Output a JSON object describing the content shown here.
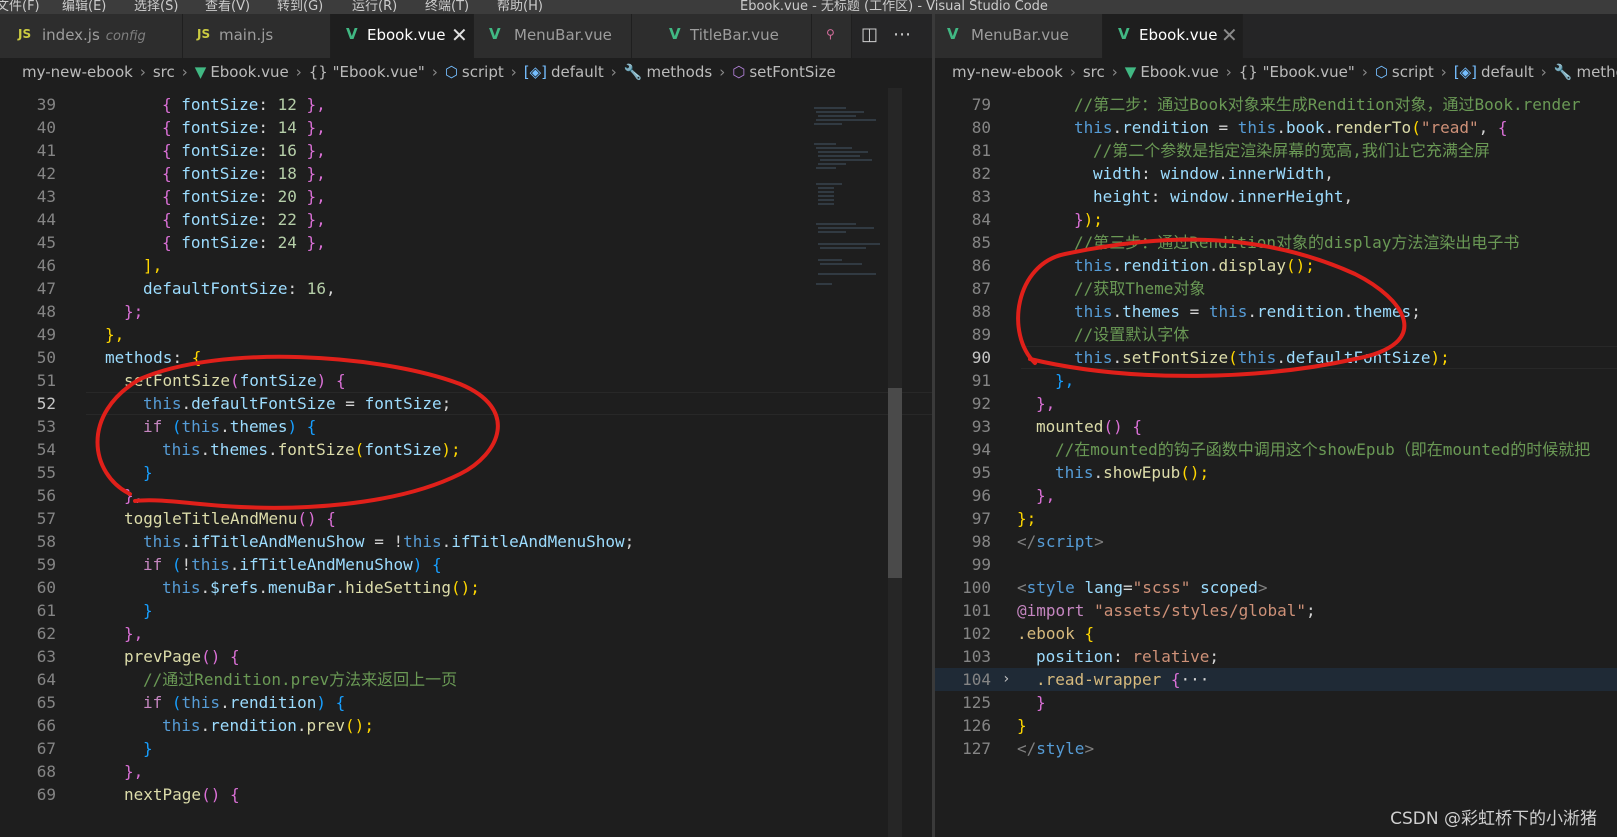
{
  "menubar": {
    "items": [
      "文件(F)",
      "编辑(E)",
      "选择(S)",
      "查看(V)",
      "转到(G)",
      "运行(R)",
      "终端(T)",
      "帮助(H)"
    ],
    "window_title": "Ebook.vue - 无标题 (工作区) - Visual Studio Code"
  },
  "left_pane": {
    "tabs": [
      {
        "icon": "JS",
        "label": "index.js",
        "description": "config",
        "active": false
      },
      {
        "icon": "JS",
        "label": "main.js",
        "active": false
      },
      {
        "icon": "V",
        "label": "Ebook.vue",
        "active": true
      },
      {
        "icon": "V",
        "label": "MenuBar.vue",
        "active": false
      },
      {
        "icon": "V",
        "label": "TitleBar.vue",
        "active": false
      }
    ],
    "breadcrumb": [
      "my-new-ebook",
      "src",
      "Ebook.vue",
      "{} \"Ebook.vue\"",
      "script",
      "default",
      "methods",
      "setFontSize"
    ],
    "current_line": "52"
  },
  "right_pane": {
    "tabs": [
      {
        "icon": "V",
        "label": "MenuBar.vue",
        "active": false
      },
      {
        "icon": "V",
        "label": "Ebook.vue",
        "active": true
      }
    ],
    "breadcrumb": [
      "my-new-ebook",
      "src",
      "Ebook.vue",
      "{} \"Ebook.vue\"",
      "script",
      "default",
      "metho"
    ],
    "current_line": "90"
  },
  "left_code": [
    {
      "n": "39",
      "indent": 4,
      "tokens": [
        [
          "{ ",
          "t-pk"
        ],
        [
          "fontSize",
          "t-p"
        ],
        [
          ": ",
          "t-d"
        ],
        [
          "12",
          "t-n"
        ],
        [
          " },",
          "t-pk"
        ]
      ]
    },
    {
      "n": "40",
      "indent": 4,
      "tokens": [
        [
          "{ ",
          "t-pk"
        ],
        [
          "fontSize",
          "t-p"
        ],
        [
          ": ",
          "t-d"
        ],
        [
          "14",
          "t-n"
        ],
        [
          " },",
          "t-pk"
        ]
      ]
    },
    {
      "n": "41",
      "indent": 4,
      "tokens": [
        [
          "{ ",
          "t-pk"
        ],
        [
          "fontSize",
          "t-p"
        ],
        [
          ": ",
          "t-d"
        ],
        [
          "16",
          "t-n"
        ],
        [
          " },",
          "t-pk"
        ]
      ]
    },
    {
      "n": "42",
      "indent": 4,
      "tokens": [
        [
          "{ ",
          "t-pk"
        ],
        [
          "fontSize",
          "t-p"
        ],
        [
          ": ",
          "t-d"
        ],
        [
          "18",
          "t-n"
        ],
        [
          " },",
          "t-pk"
        ]
      ]
    },
    {
      "n": "43",
      "indent": 4,
      "tokens": [
        [
          "{ ",
          "t-pk"
        ],
        [
          "fontSize",
          "t-p"
        ],
        [
          ": ",
          "t-d"
        ],
        [
          "20",
          "t-n"
        ],
        [
          " },",
          "t-pk"
        ]
      ]
    },
    {
      "n": "44",
      "indent": 4,
      "tokens": [
        [
          "{ ",
          "t-pk"
        ],
        [
          "fontSize",
          "t-p"
        ],
        [
          ": ",
          "t-d"
        ],
        [
          "22",
          "t-n"
        ],
        [
          " },",
          "t-pk"
        ]
      ]
    },
    {
      "n": "45",
      "indent": 4,
      "tokens": [
        [
          "{ ",
          "t-pk"
        ],
        [
          "fontSize",
          "t-p"
        ],
        [
          ": ",
          "t-d"
        ],
        [
          "24",
          "t-n"
        ],
        [
          " },",
          "t-pk"
        ]
      ]
    },
    {
      "n": "46",
      "indent": 3,
      "tokens": [
        [
          "],",
          "t-y"
        ]
      ]
    },
    {
      "n": "47",
      "indent": 3,
      "tokens": [
        [
          "defaultFontSize",
          "t-p"
        ],
        [
          ": ",
          "t-d"
        ],
        [
          "16",
          "t-n"
        ],
        [
          ",",
          "t-d"
        ]
      ]
    },
    {
      "n": "48",
      "indent": 2,
      "tokens": [
        [
          "};",
          "t-pk"
        ]
      ]
    },
    {
      "n": "49",
      "indent": 1,
      "tokens": [
        [
          "},",
          "t-y"
        ]
      ]
    },
    {
      "n": "50",
      "indent": 1,
      "tokens": [
        [
          "methods",
          "t-p"
        ],
        [
          ": ",
          "t-d"
        ],
        [
          "{",
          "t-y"
        ]
      ]
    },
    {
      "n": "51",
      "indent": 2,
      "tokens": [
        [
          "setFontSize",
          "t-f"
        ],
        [
          "(",
          "t-pk"
        ],
        [
          "fontSize",
          "t-p"
        ],
        [
          ") ",
          "t-pk"
        ],
        [
          "{",
          "t-pk"
        ]
      ]
    },
    {
      "n": "52",
      "indent": 3,
      "tokens": [
        [
          "this",
          "t-k"
        ],
        [
          ".",
          "t-d"
        ],
        [
          "defaultFontSize",
          "t-p"
        ],
        [
          " = ",
          "t-d"
        ],
        [
          "fontSize",
          "t-p"
        ],
        [
          ";",
          "t-d"
        ]
      ]
    },
    {
      "n": "53",
      "indent": 3,
      "tokens": [
        [
          "if",
          "t-c"
        ],
        [
          " (",
          "t-b"
        ],
        [
          "this",
          "t-k"
        ],
        [
          ".",
          "t-d"
        ],
        [
          "themes",
          "t-p"
        ],
        [
          ") ",
          "t-b"
        ],
        [
          "{",
          "t-b"
        ]
      ]
    },
    {
      "n": "54",
      "indent": 4,
      "tokens": [
        [
          "this",
          "t-k"
        ],
        [
          ".",
          "t-d"
        ],
        [
          "themes",
          "t-p"
        ],
        [
          ".",
          "t-d"
        ],
        [
          "fontSize",
          "t-f"
        ],
        [
          "(",
          "t-y"
        ],
        [
          "fontSize",
          "t-p"
        ],
        [
          ");",
          "t-y"
        ]
      ]
    },
    {
      "n": "55",
      "indent": 3,
      "tokens": [
        [
          "}",
          "t-b"
        ]
      ]
    },
    {
      "n": "56",
      "indent": 2,
      "tokens": [
        [
          "},",
          "t-pk"
        ]
      ]
    },
    {
      "n": "57",
      "indent": 2,
      "tokens": [
        [
          "toggleTitleAndMenu",
          "t-f"
        ],
        [
          "() ",
          "t-pk"
        ],
        [
          "{",
          "t-pk"
        ]
      ]
    },
    {
      "n": "58",
      "indent": 3,
      "tokens": [
        [
          "this",
          "t-k"
        ],
        [
          ".",
          "t-d"
        ],
        [
          "ifTitleAndMenuShow",
          "t-p"
        ],
        [
          " = !",
          "t-d"
        ],
        [
          "this",
          "t-k"
        ],
        [
          ".",
          "t-d"
        ],
        [
          "ifTitleAndMenuShow",
          "t-p"
        ],
        [
          ";",
          "t-d"
        ]
      ]
    },
    {
      "n": "59",
      "indent": 3,
      "tokens": [
        [
          "if",
          "t-c"
        ],
        [
          " (",
          "t-b"
        ],
        [
          "!",
          "t-d"
        ],
        [
          "this",
          "t-k"
        ],
        [
          ".",
          "t-d"
        ],
        [
          "ifTitleAndMenuShow",
          "t-p"
        ],
        [
          ") ",
          "t-b"
        ],
        [
          "{",
          "t-b"
        ]
      ]
    },
    {
      "n": "60",
      "indent": 4,
      "tokens": [
        [
          "this",
          "t-k"
        ],
        [
          ".",
          "t-d"
        ],
        [
          "$refs",
          "t-p"
        ],
        [
          ".",
          "t-d"
        ],
        [
          "menuBar",
          "t-p"
        ],
        [
          ".",
          "t-d"
        ],
        [
          "hideSetting",
          "t-f"
        ],
        [
          "();",
          "t-y"
        ]
      ]
    },
    {
      "n": "61",
      "indent": 3,
      "tokens": [
        [
          "}",
          "t-b"
        ]
      ]
    },
    {
      "n": "62",
      "indent": 2,
      "tokens": [
        [
          "},",
          "t-pk"
        ]
      ]
    },
    {
      "n": "63",
      "indent": 2,
      "tokens": [
        [
          "prevPage",
          "t-f"
        ],
        [
          "() ",
          "t-pk"
        ],
        [
          "{",
          "t-pk"
        ]
      ]
    },
    {
      "n": "64",
      "indent": 3,
      "tokens": [
        [
          "//通过Rendition.prev方法来返回上一页",
          "t-m"
        ]
      ]
    },
    {
      "n": "65",
      "indent": 3,
      "tokens": [
        [
          "if",
          "t-c"
        ],
        [
          " (",
          "t-b"
        ],
        [
          "this",
          "t-k"
        ],
        [
          ".",
          "t-d"
        ],
        [
          "rendition",
          "t-p"
        ],
        [
          ") ",
          "t-b"
        ],
        [
          "{",
          "t-b"
        ]
      ]
    },
    {
      "n": "66",
      "indent": 4,
      "tokens": [
        [
          "this",
          "t-k"
        ],
        [
          ".",
          "t-d"
        ],
        [
          "rendition",
          "t-p"
        ],
        [
          ".",
          "t-d"
        ],
        [
          "prev",
          "t-f"
        ],
        [
          "();",
          "t-y"
        ]
      ]
    },
    {
      "n": "67",
      "indent": 3,
      "tokens": [
        [
          "}",
          "t-b"
        ]
      ]
    },
    {
      "n": "68",
      "indent": 2,
      "tokens": [
        [
          "},",
          "t-pk"
        ]
      ]
    },
    {
      "n": "69",
      "indent": 2,
      "tokens": [
        [
          "nextPage",
          "t-f"
        ],
        [
          "() ",
          "t-pk"
        ],
        [
          "{",
          "t-pk"
        ]
      ]
    }
  ],
  "right_code": [
    {
      "n": "79",
      "indent": 3,
      "tokens": [
        [
          "//第二步：通过Book对象来生成Rendition对象，通过Book.render",
          "t-m"
        ]
      ]
    },
    {
      "n": "80",
      "indent": 3,
      "tokens": [
        [
          "this",
          "t-k"
        ],
        [
          ".",
          "t-d"
        ],
        [
          "rendition",
          "t-p"
        ],
        [
          " = ",
          "t-d"
        ],
        [
          "this",
          "t-k"
        ],
        [
          ".",
          "t-d"
        ],
        [
          "book",
          "t-p"
        ],
        [
          ".",
          "t-d"
        ],
        [
          "renderTo",
          "t-f"
        ],
        [
          "(",
          "t-y"
        ],
        [
          "\"read\"",
          "t-s"
        ],
        [
          ", ",
          "t-d"
        ],
        [
          "{",
          "t-pk"
        ]
      ]
    },
    {
      "n": "81",
      "indent": 4,
      "tokens": [
        [
          "//第二个参数是指定渲染屏幕的宽高,我们让它充满全屏",
          "t-m"
        ]
      ]
    },
    {
      "n": "82",
      "indent": 4,
      "tokens": [
        [
          "width",
          "t-p"
        ],
        [
          ": ",
          "t-d"
        ],
        [
          "window",
          "t-p"
        ],
        [
          ".",
          "t-d"
        ],
        [
          "innerWidth",
          "t-p"
        ],
        [
          ",",
          "t-d"
        ]
      ]
    },
    {
      "n": "83",
      "indent": 4,
      "tokens": [
        [
          "height",
          "t-p"
        ],
        [
          ": ",
          "t-d"
        ],
        [
          "window",
          "t-p"
        ],
        [
          ".",
          "t-d"
        ],
        [
          "innerHeight",
          "t-p"
        ],
        [
          ",",
          "t-d"
        ]
      ]
    },
    {
      "n": "84",
      "indent": 3,
      "tokens": [
        [
          "}",
          "t-pk"
        ],
        [
          ");",
          "t-y"
        ]
      ]
    },
    {
      "n": "85",
      "indent": 3,
      "tokens": [
        [
          "//第三步：通过Rendition对象的display方法渲染出电子书",
          "t-m"
        ]
      ]
    },
    {
      "n": "86",
      "indent": 3,
      "tokens": [
        [
          "this",
          "t-k"
        ],
        [
          ".",
          "t-d"
        ],
        [
          "rendition",
          "t-p"
        ],
        [
          ".",
          "t-d"
        ],
        [
          "display",
          "t-f"
        ],
        [
          "();",
          "t-y"
        ]
      ]
    },
    {
      "n": "87",
      "indent": 3,
      "tokens": [
        [
          "//获取Theme对象",
          "t-m"
        ]
      ]
    },
    {
      "n": "88",
      "indent": 3,
      "tokens": [
        [
          "this",
          "t-k"
        ],
        [
          ".",
          "t-d"
        ],
        [
          "themes",
          "t-p"
        ],
        [
          " = ",
          "t-d"
        ],
        [
          "this",
          "t-k"
        ],
        [
          ".",
          "t-d"
        ],
        [
          "rendition",
          "t-p"
        ],
        [
          ".",
          "t-d"
        ],
        [
          "themes",
          "t-p"
        ],
        [
          ";",
          "t-d"
        ]
      ]
    },
    {
      "n": "89",
      "indent": 3,
      "tokens": [
        [
          "//设置默认字体",
          "t-m"
        ]
      ]
    },
    {
      "n": "90",
      "indent": 3,
      "tokens": [
        [
          "this",
          "t-k"
        ],
        [
          ".",
          "t-d"
        ],
        [
          "setFontSize",
          "t-f"
        ],
        [
          "(",
          "t-y"
        ],
        [
          "this",
          "t-k"
        ],
        [
          ".",
          "t-d"
        ],
        [
          "defaultFontSize",
          "t-p"
        ],
        [
          ");",
          "t-y"
        ]
      ]
    },
    {
      "n": "91",
      "indent": 2,
      "tokens": [
        [
          "},",
          "t-b"
        ]
      ]
    },
    {
      "n": "92",
      "indent": 1,
      "tokens": [
        [
          "},",
          "t-pk"
        ]
      ]
    },
    {
      "n": "93",
      "indent": 1,
      "tokens": [
        [
          "mounted",
          "t-f"
        ],
        [
          "() ",
          "t-pk"
        ],
        [
          "{",
          "t-pk"
        ]
      ]
    },
    {
      "n": "94",
      "indent": 2,
      "tokens": [
        [
          "//在mounted的钩子函数中调用这个showEpub（即在mounted的时候就把",
          "t-m"
        ]
      ]
    },
    {
      "n": "95",
      "indent": 2,
      "tokens": [
        [
          "this",
          "t-k"
        ],
        [
          ".",
          "t-d"
        ],
        [
          "showEpub",
          "t-f"
        ],
        [
          "();",
          "t-y"
        ]
      ]
    },
    {
      "n": "96",
      "indent": 1,
      "tokens": [
        [
          "},",
          "t-pk"
        ]
      ]
    },
    {
      "n": "97",
      "indent": 0,
      "tokens": [
        [
          "};",
          "t-y"
        ]
      ]
    },
    {
      "n": "98",
      "indent": 0,
      "tokens": [
        [
          "</",
          "t-ex"
        ],
        [
          "script",
          "t-tag"
        ],
        [
          ">",
          "t-ex"
        ]
      ]
    },
    {
      "n": "99",
      "indent": 0,
      "tokens": []
    },
    {
      "n": "100",
      "indent": 0,
      "tokens": [
        [
          "<",
          "t-ex"
        ],
        [
          "style",
          "t-tag"
        ],
        [
          " ",
          "t-d"
        ],
        [
          "lang",
          "t-at"
        ],
        [
          "=",
          "t-d"
        ],
        [
          "\"scss\"",
          "t-s"
        ],
        [
          " ",
          "t-d"
        ],
        [
          "scoped",
          "t-at"
        ],
        [
          ">",
          "t-ex"
        ]
      ]
    },
    {
      "n": "101",
      "indent": 0,
      "tokens": [
        [
          "@import",
          "t-c"
        ],
        [
          " ",
          "t-d"
        ],
        [
          "\"assets/styles/global\"",
          "t-s"
        ],
        [
          ";",
          "t-d"
        ]
      ]
    },
    {
      "n": "102",
      "indent": 0,
      "tokens": [
        [
          ".ebook",
          "t-sel"
        ],
        [
          " ",
          "t-d"
        ],
        [
          "{",
          "t-y"
        ]
      ]
    },
    {
      "n": "103",
      "indent": 1,
      "tokens": [
        [
          "position",
          "t-at"
        ],
        [
          ": ",
          "t-d"
        ],
        [
          "relative",
          "t-cv"
        ],
        [
          ";",
          "t-d"
        ]
      ]
    },
    {
      "n": "104",
      "indent": 1,
      "fold": true,
      "tokens": [
        [
          ".read-wrapper",
          "t-sel"
        ],
        [
          " ",
          "t-d"
        ],
        [
          "{",
          "t-pk"
        ],
        [
          "···",
          "t-d"
        ]
      ]
    },
    {
      "n": "125",
      "indent": 1,
      "tokens": [
        [
          "}",
          "t-pk"
        ]
      ]
    },
    {
      "n": "126",
      "indent": 0,
      "tokens": [
        [
          "}",
          "t-y"
        ]
      ]
    },
    {
      "n": "127",
      "indent": 0,
      "tokens": [
        [
          "</",
          "t-ex"
        ],
        [
          "style",
          "t-tag"
        ],
        [
          ">",
          "t-ex"
        ]
      ]
    }
  ],
  "colors": {
    "editor_bg": "#1e1e1e",
    "annotation": "#e0201a",
    "vue_icon": "#41b883",
    "js_icon": "#cbcb41"
  },
  "watermark": "CSDN @彩虹桥下的小淅猪"
}
